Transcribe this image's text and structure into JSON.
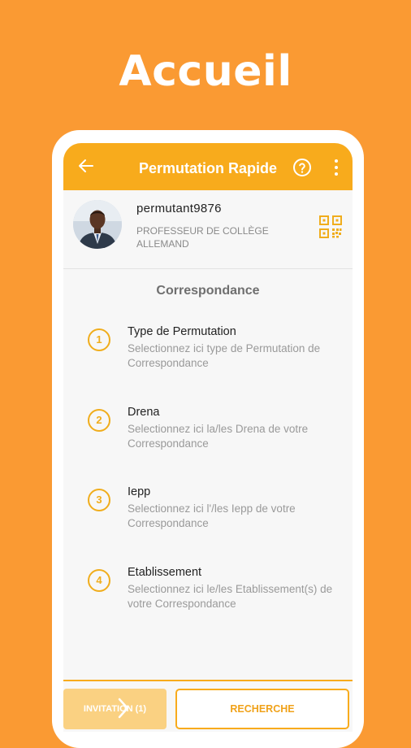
{
  "headline": "Accueil",
  "appbar": {
    "title": "Permutation Rapide",
    "back_icon": "arrow-left-icon",
    "help_icon": "help-circle-icon",
    "more_icon": "more-vertical-icon"
  },
  "profile": {
    "username": "permutant9876",
    "role_line1": "PROFESSEUR DE COLLÈGE",
    "role_line2": "ALLEMAND",
    "qr_icon": "qr-code-icon"
  },
  "section_title": "Correspondance",
  "steps": [
    {
      "num": "1",
      "title": "Type de Permutation",
      "desc": "Selectionnez ici type de Permutation de Correspondance"
    },
    {
      "num": "2",
      "title": "Drena",
      "desc": "Selectionnez ici la/les Drena de votre Correspondance"
    },
    {
      "num": "3",
      "title": "Iepp",
      "desc": "Selectionnez ici l'/les Iepp de votre Correspondance"
    },
    {
      "num": "4",
      "title": "Etablissement",
      "desc": "Selectionnez ici le/les Etablissement(s) de votre Correspondance"
    }
  ],
  "buttons": {
    "invitation": "INVITATION (1)",
    "recherche": "RECHERCHE"
  },
  "colors": {
    "background": "#fa9a33",
    "accent": "#f8ab1c"
  }
}
